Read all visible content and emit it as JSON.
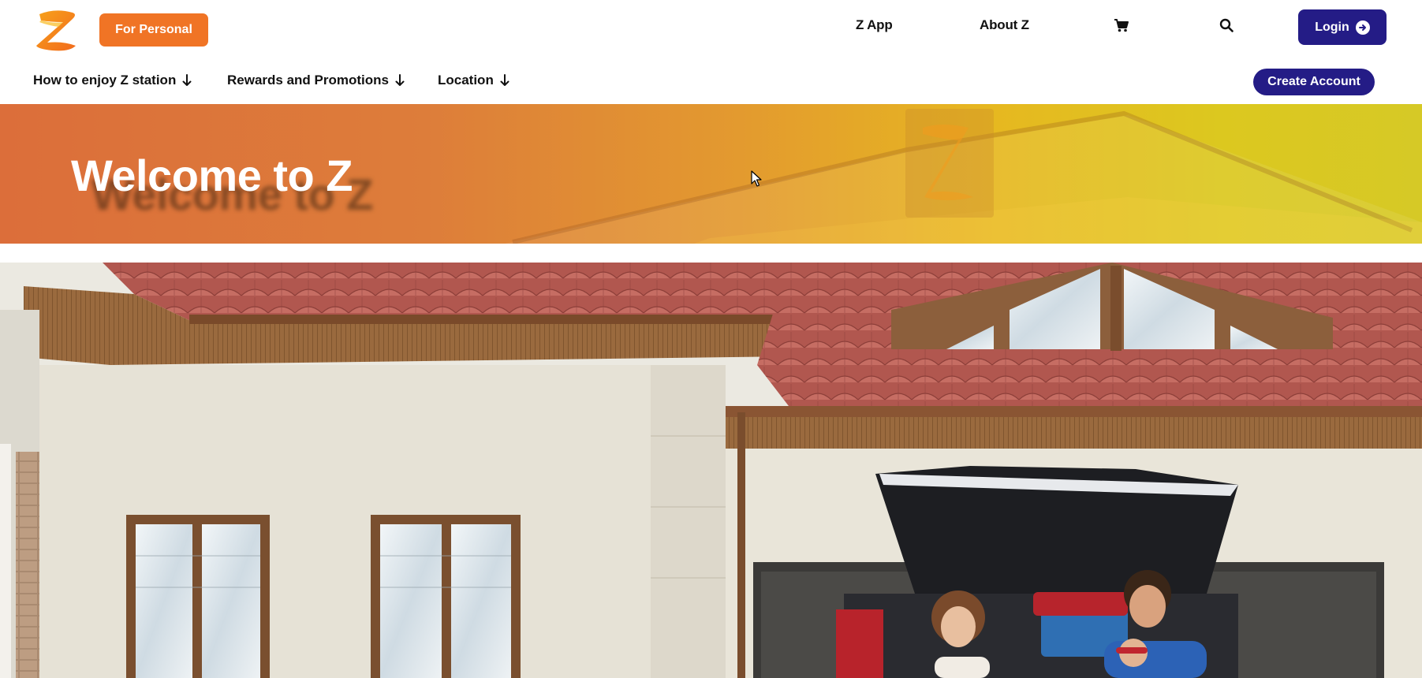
{
  "header": {
    "for_personal": "For Personal",
    "links": {
      "z_app": "Z App",
      "about_z": "About Z"
    },
    "login": "Login",
    "icons": {
      "logo": "z-logo",
      "cart": "cart-icon",
      "search": "search-icon",
      "login_arrow": "arrow-right-circle-icon"
    }
  },
  "nav": {
    "items": [
      {
        "label": "How to enjoy Z station",
        "icon": "arrow-down-icon"
      },
      {
        "label": "Rewards and Promotions",
        "icon": "arrow-down-icon"
      },
      {
        "label": "Location",
        "icon": "arrow-down-icon"
      }
    ],
    "create_account": "Create Account"
  },
  "banner": {
    "title": "Welcome to Z"
  },
  "colors": {
    "accent_orange": "#f07425",
    "brand_navy": "#241c86"
  }
}
